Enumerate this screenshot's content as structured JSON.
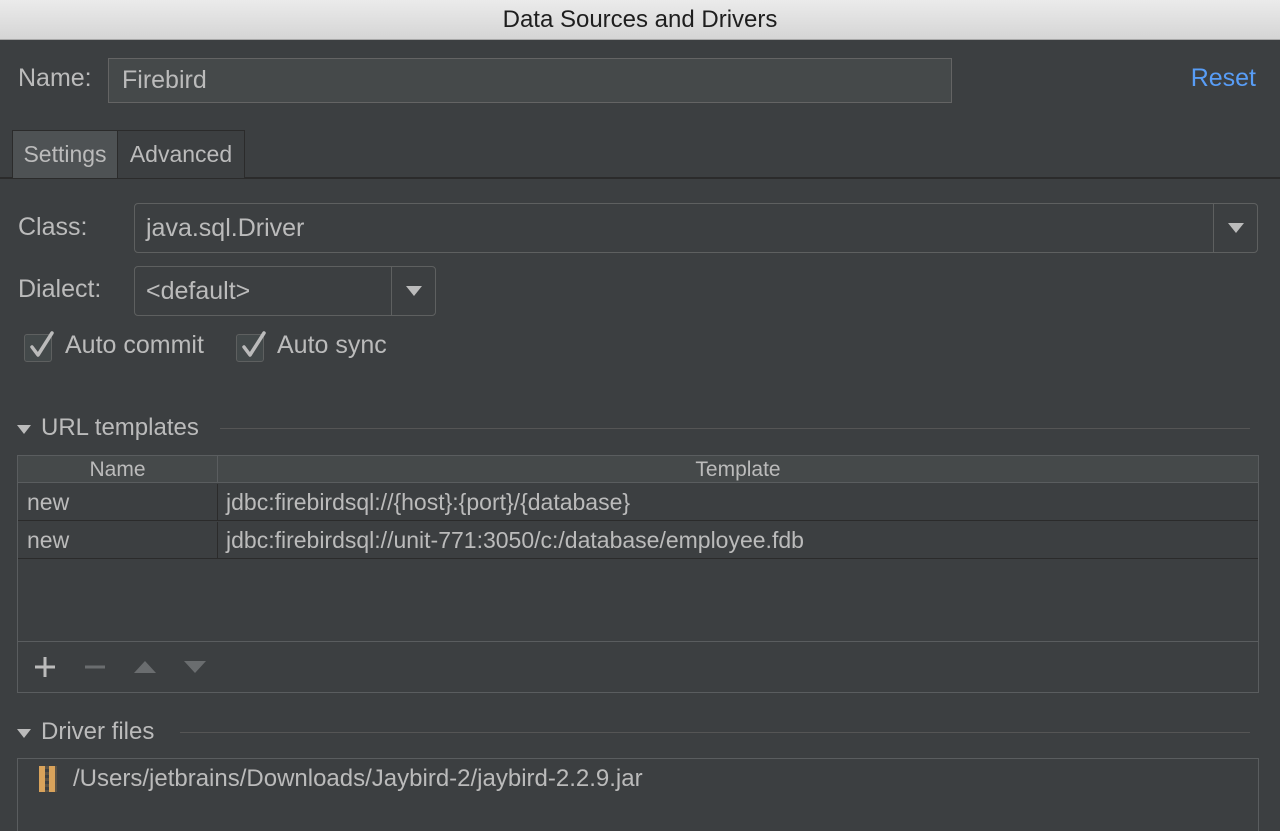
{
  "window": {
    "title": "Data Sources and Drivers"
  },
  "name": {
    "label": "Name:",
    "value": "Firebird",
    "reset_label": "Reset"
  },
  "tabs": [
    {
      "label": "Settings",
      "active": true
    },
    {
      "label": "Advanced",
      "active": false
    }
  ],
  "settings": {
    "class_label": "Class:",
    "class_value": "java.sql.Driver",
    "dialect_label": "Dialect:",
    "dialect_value": "<default>",
    "auto_commit_label": "Auto commit",
    "auto_commit_checked": true,
    "auto_sync_label": "Auto sync",
    "auto_sync_checked": true
  },
  "url_templates": {
    "section_label": "URL templates",
    "columns": [
      "Name",
      "Template"
    ],
    "rows": [
      {
        "name": "new",
        "template": "jdbc:firebirdsql://{host}:{port}/{database}"
      },
      {
        "name": "new",
        "template": "jdbc:firebirdsql://unit-771:3050/c:/database/employee.fdb"
      }
    ],
    "toolbar_icons": [
      "add-icon",
      "remove-icon",
      "move-up-icon",
      "move-down-icon"
    ]
  },
  "driver_files": {
    "section_label": "Driver files",
    "files": [
      "/Users/jetbrains/Downloads/Jaybird-2/jaybird-2.2.9.jar"
    ]
  },
  "colors": {
    "background": "#3c3f41",
    "link": "#589df6",
    "text": "#bbbbbb",
    "jar_icon": "#d9a35b"
  }
}
